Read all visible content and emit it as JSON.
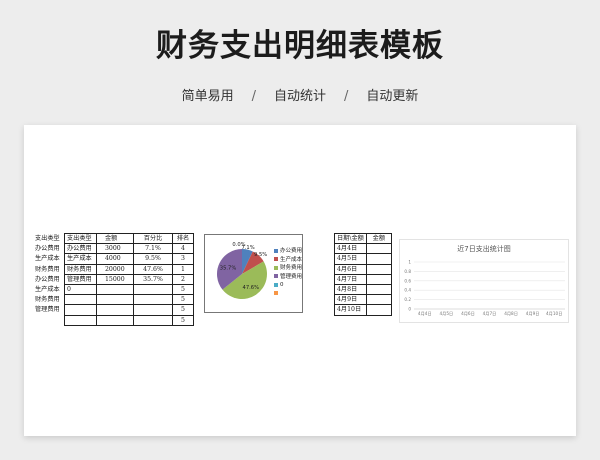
{
  "header": {
    "title": "财务支出明细表模板",
    "subtitle_items": [
      "简单易用",
      "自动统计",
      "自动更新"
    ],
    "separator": "/"
  },
  "summary_table": {
    "headers": [
      "支出类型",
      "支出类型",
      "金额",
      "百分比",
      "排名"
    ],
    "rows": [
      [
        "办公费用",
        "办公费用",
        "3000",
        "7.1%",
        "4"
      ],
      [
        "生产成本",
        "生产成本",
        "4000",
        "9.5%",
        "3"
      ],
      [
        "财务费用",
        "财务费用",
        "20000",
        "47.6%",
        "1"
      ],
      [
        "办公费用",
        "管理费用",
        "15000",
        "35.7%",
        "2"
      ],
      [
        "生产成本",
        "0",
        "",
        "",
        "5"
      ],
      [
        "财务费用",
        "",
        "",
        "",
        "5"
      ],
      [
        "管理费用",
        "",
        "",
        "",
        "5"
      ],
      [
        "",
        "",
        "",
        "",
        "5"
      ]
    ]
  },
  "date_table": {
    "headers": [
      "日期\\金额",
      "金额"
    ],
    "rows": [
      [
        "4月4日",
        ""
      ],
      [
        "4月5日",
        ""
      ],
      [
        "4月6日",
        ""
      ],
      [
        "4月7日",
        ""
      ],
      [
        "4月8日",
        ""
      ],
      [
        "4月9日",
        ""
      ],
      [
        "4月10日",
        ""
      ]
    ]
  },
  "chart_data": [
    {
      "type": "pie",
      "categories": [
        "办公费用",
        "生产成本",
        "财务费用",
        "管理费用",
        "0",
        ""
      ],
      "values": [
        7.1,
        9.5,
        47.6,
        35.7,
        0,
        0
      ],
      "data_labels": [
        "7.1%",
        "9.5%",
        "47.6%",
        "35.7%",
        "0.0%",
        ""
      ],
      "colors": [
        "#4f81bd",
        "#c0504d",
        "#9bbb59",
        "#8064a2",
        "#4bacc6",
        "#f79646"
      ],
      "title": "",
      "legend": "right"
    },
    {
      "type": "bar",
      "title": "近7日支出统计图",
      "categories": [
        "4月4日",
        "4月5日",
        "4月6日",
        "4月7日",
        "4月8日",
        "4月9日",
        "4月10日"
      ],
      "values": [
        0,
        0,
        0,
        0,
        0,
        0,
        0
      ],
      "ylim": [
        0,
        1
      ],
      "yticks": [
        "0",
        "0.2",
        "0.4",
        "0.6",
        "0.8",
        "1"
      ],
      "xlabel": "",
      "ylabel": "",
      "grid": true
    }
  ]
}
